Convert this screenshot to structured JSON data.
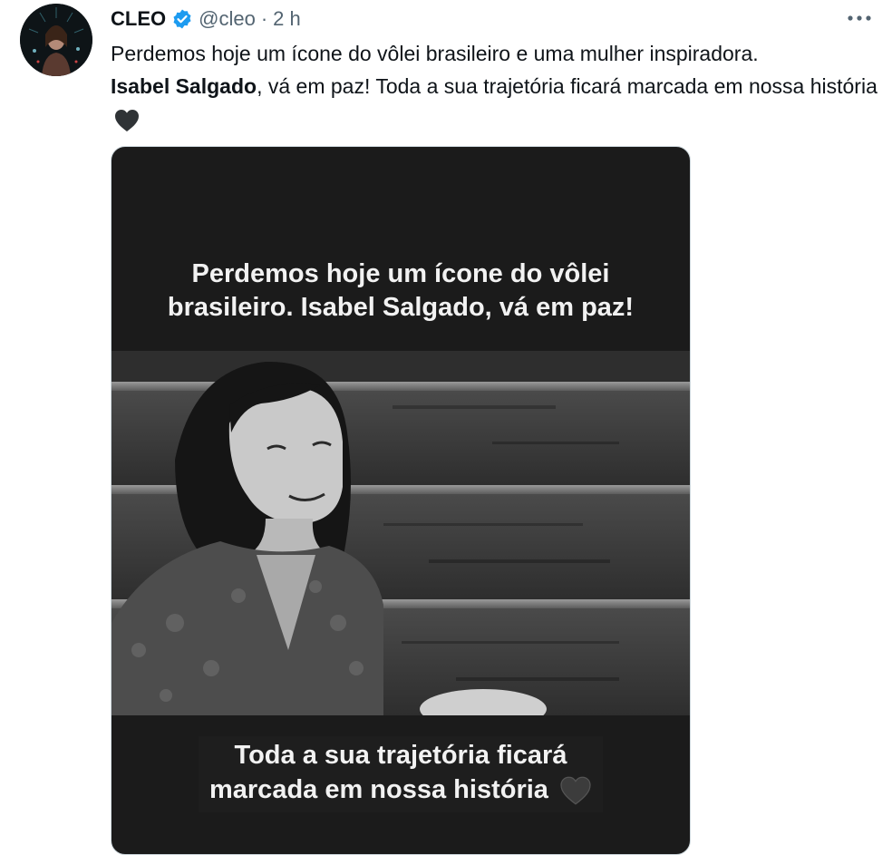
{
  "tweet": {
    "author": {
      "display_name": "CLEO",
      "handle": "@cleo",
      "separator": "·",
      "time": "2 h",
      "verified_icon": "verified-badge-icon"
    },
    "more_icon": "more-options-icon",
    "text": {
      "line1": "Perdemos hoje um ícone do vôlei brasileiro e uma mulher inspiradora.",
      "bold_name": "Isabel Salgado",
      "rest": ", vá em paz! Toda a sua trajetória ficará marcada em nossa história",
      "emoji": "black-heart-icon"
    },
    "media": {
      "caption_top_line1": "Perdemos hoje um ícone do vôlei",
      "caption_top_line2": "brasileiro. Isabel Salgado, vá em paz!",
      "caption_bottom_line1": "Toda a sua trajetória ficará",
      "caption_bottom_line2": "marcada em nossa história",
      "caption_emoji": "gray-heart-icon"
    },
    "colors": {
      "verified": "#1d9bf0",
      "secondary_text": "#536471",
      "media_bg": "#1b1b1b"
    }
  }
}
